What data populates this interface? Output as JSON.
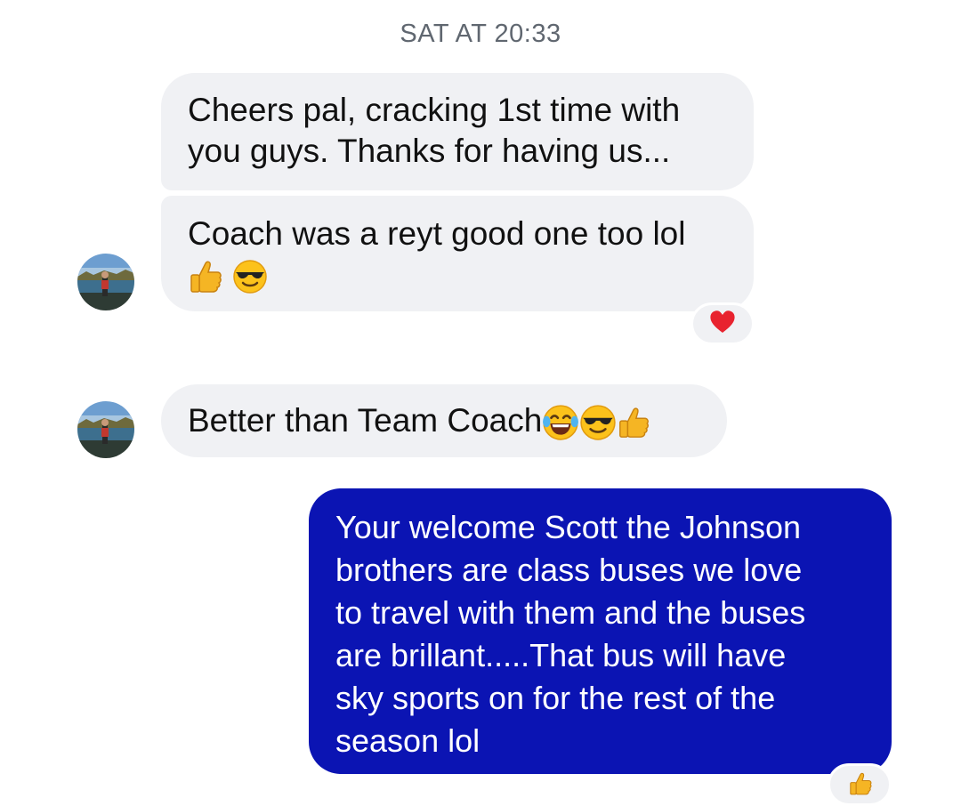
{
  "thread": {
    "timestamp": "SAT AT 20:33"
  },
  "messages": [
    {
      "sender": "contact",
      "lines": [
        "Cheers pal, cracking 1st time with",
        "you guys. Thanks for having us..."
      ]
    },
    {
      "sender": "contact",
      "lines": [
        "Coach was a reyt good one too lol"
      ],
      "emojis": [
        "thumbs-up-emoji",
        "sunglasses-face-emoji"
      ],
      "reaction": "red-heart-icon"
    },
    {
      "sender": "contact",
      "lines": [
        "Better than Team Coach"
      ],
      "emojis": [
        "tears-of-joy-emoji",
        "sunglasses-face-emoji",
        "thumbs-up-emoji"
      ]
    },
    {
      "sender": "me",
      "lines": [
        "Your welcome Scott the Johnson",
        "brothers are class buses we love",
        "to travel with them and the buses",
        "are brillant.....That bus will have",
        "sky sports on for the rest of the",
        "season lol"
      ],
      "reaction": "thumbs-up-emoji"
    }
  ],
  "colors": {
    "incoming_bubble": "#f0f1f4",
    "outgoing_bubble": "#0b14b3",
    "timestamp_text": "#606770",
    "heart": "#e8232f"
  }
}
